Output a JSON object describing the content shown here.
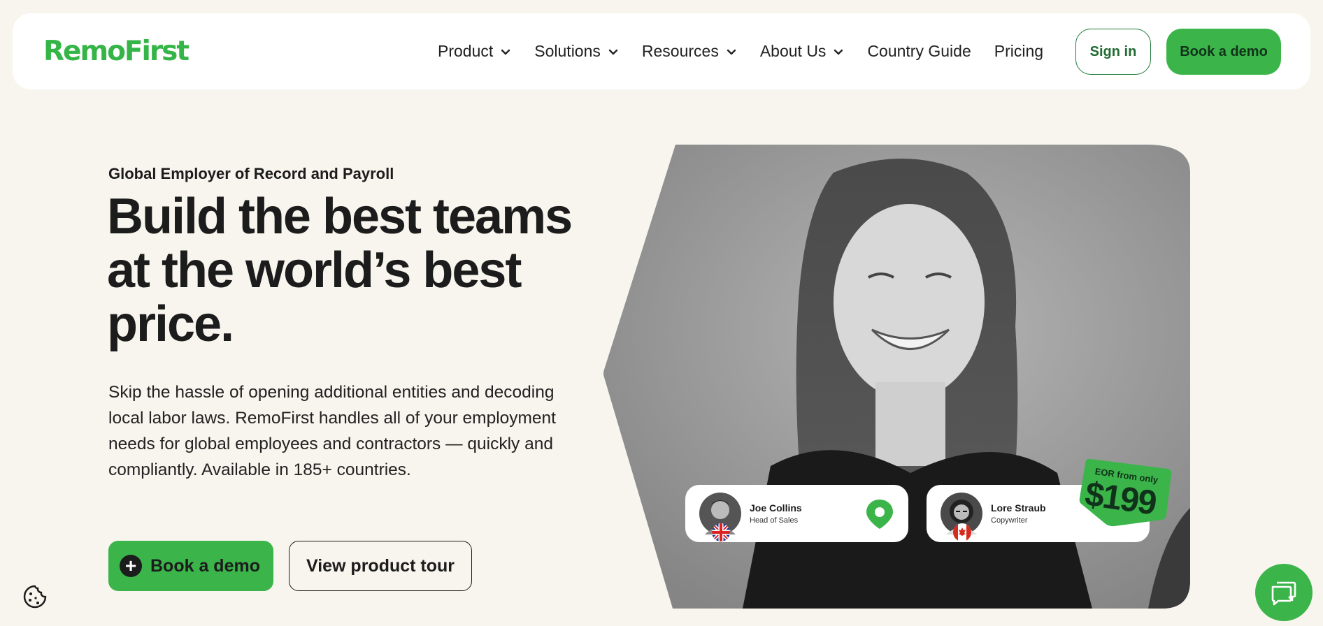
{
  "nav": {
    "logo": "RemoFirst",
    "items": [
      {
        "label": "Product",
        "has_dropdown": true
      },
      {
        "label": "Solutions",
        "has_dropdown": true
      },
      {
        "label": "Resources",
        "has_dropdown": true
      },
      {
        "label": "About Us",
        "has_dropdown": true
      },
      {
        "label": "Country Guide",
        "has_dropdown": false
      },
      {
        "label": "Pricing",
        "has_dropdown": false
      }
    ],
    "signin_label": "Sign in",
    "demo_label": "Book a demo"
  },
  "hero": {
    "eyebrow": "Global Employer of Record and Payroll",
    "headline": "Build the best teams at the world’s best price.",
    "paragraph": "Skip the hassle of opening additional entities and decoding local labor laws. RemoFirst handles all of your employment needs for global employees and contractors — quickly and compliantly. Available in 185+ countries.",
    "primary_cta": "Book a demo",
    "secondary_cta": "View product tour"
  },
  "image_cards": [
    {
      "name": "Joe Collins",
      "role": "Head of Sales",
      "flag_icon": "uk-flag-icon",
      "badge_icon": "location-pin-icon"
    },
    {
      "name": "Lore Straub",
      "role": "Copywriter",
      "flag_icon": "canada-flag-icon"
    }
  ],
  "price_tag": {
    "caption": "EOR from only",
    "price": "$199"
  },
  "colors": {
    "brand_green": "#3bb54a",
    "background": "#f8f5ee",
    "text": "#1c1c1c"
  },
  "icons": {
    "cookie": "cookie-icon",
    "chat": "chat-icon",
    "dropdown": "chevron-down-icon"
  }
}
